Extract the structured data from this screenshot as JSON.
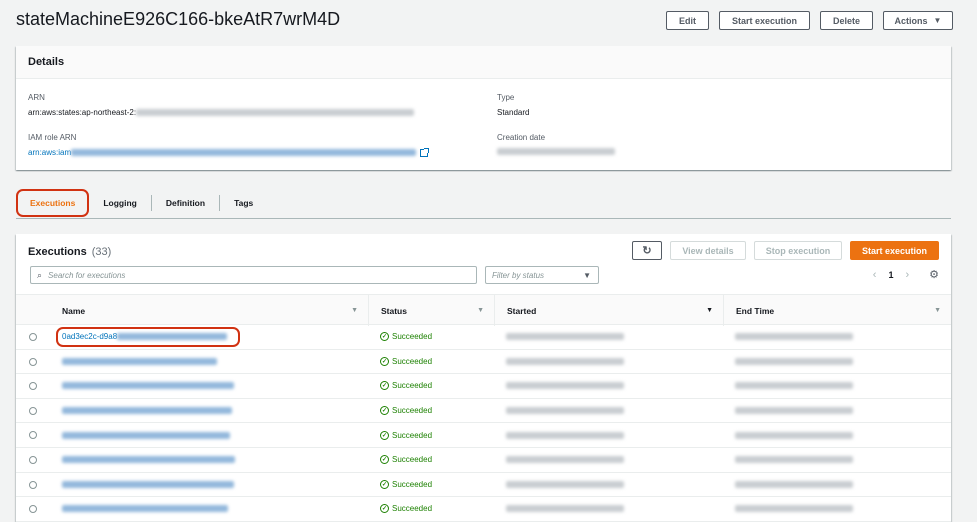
{
  "title": "stateMachineE926C166-bkeAtR7wrM4D",
  "top_actions": {
    "edit": "Edit",
    "start_execution": "Start execution",
    "delete": "Delete",
    "actions": "Actions"
  },
  "details": {
    "heading": "Details",
    "arn_label": "ARN",
    "arn_value_visible": "arn:aws:states:ap-northeast-2:",
    "iam_label": "IAM role ARN",
    "iam_value_visible": "arn:aws:iam",
    "type_label": "Type",
    "type_value": "Standard",
    "creation_label": "Creation date"
  },
  "tabs": [
    "Executions",
    "Logging",
    "Definition",
    "Tags"
  ],
  "executions": {
    "heading": "Executions",
    "count": "(33)",
    "view_details": "View details",
    "stop_execution": "Stop execution",
    "start_execution": "Start execution",
    "search_placeholder": "Search for executions",
    "filter_placeholder": "Filter by status",
    "page": "1",
    "columns": [
      "Name",
      "Status",
      "Started",
      "End Time"
    ],
    "rows": [
      {
        "name": "0ad3ec2c-d9a8",
        "status": "Succeeded"
      },
      {
        "name": "",
        "status": "Succeeded"
      },
      {
        "name": "",
        "status": "Succeeded"
      },
      {
        "name": "",
        "status": "Succeeded"
      },
      {
        "name": "",
        "status": "Succeeded"
      },
      {
        "name": "",
        "status": "Succeeded"
      },
      {
        "name": "",
        "status": "Succeeded"
      },
      {
        "name": "",
        "status": "Succeeded"
      }
    ]
  },
  "colors": {
    "accent": "#ec7211",
    "link": "#0073bb",
    "success": "#1d8102",
    "highlight": "#d13212"
  }
}
